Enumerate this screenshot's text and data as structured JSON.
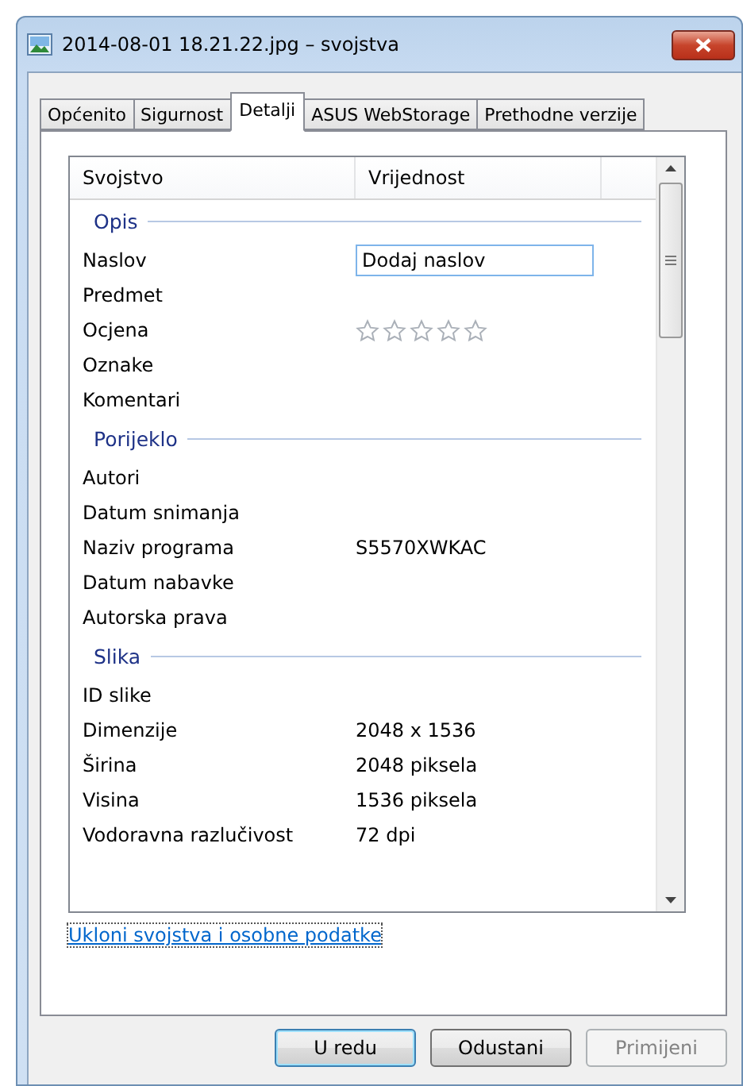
{
  "window": {
    "title": "2014-08-01 18.21.22.jpg – svojstva"
  },
  "tabs": [
    {
      "label": "Općenito",
      "selected": false
    },
    {
      "label": "Sigurnost",
      "selected": false
    },
    {
      "label": "Detalji",
      "selected": true
    },
    {
      "label": "ASUS WebStorage",
      "selected": false
    },
    {
      "label": "Prethodne verzije",
      "selected": false
    }
  ],
  "table": {
    "columns": [
      "Svojstvo",
      "Vrijednost"
    ],
    "groups": [
      {
        "title": "Opis",
        "rows": [
          {
            "kind": "field",
            "name": "Naslov",
            "placeholder": "Dodaj naslov"
          },
          {
            "kind": "text",
            "name": "Predmet"
          },
          {
            "kind": "stars",
            "name": "Ocjena",
            "stars": 0
          },
          {
            "kind": "text",
            "name": "Oznake"
          },
          {
            "kind": "text",
            "name": "Komentari"
          }
        ]
      },
      {
        "title": "Porijeklo",
        "rows": [
          {
            "kind": "text",
            "name": "Autori"
          },
          {
            "kind": "text",
            "name": "Datum snimanja"
          },
          {
            "kind": "text",
            "name": "Naziv programa",
            "value": "S5570XWKAC"
          },
          {
            "kind": "text",
            "name": "Datum nabavke"
          },
          {
            "kind": "text",
            "name": "Autorska prava"
          }
        ]
      },
      {
        "title": "Slika",
        "rows": [
          {
            "kind": "text",
            "name": "ID slike"
          },
          {
            "kind": "text",
            "name": "Dimenzije",
            "value": "2048 x 1536"
          },
          {
            "kind": "text",
            "name": "Širina",
            "value": "2048 piksela"
          },
          {
            "kind": "text",
            "name": "Visina",
            "value": "1536 piksela"
          },
          {
            "kind": "text",
            "name": "Vodoravna razlučivost",
            "value": "72 dpi"
          }
        ]
      }
    ]
  },
  "link": "Ukloni svojstva i osobne podatke",
  "buttons": [
    {
      "label": "U redu",
      "default": true,
      "disabled": false
    },
    {
      "label": "Odustani",
      "default": false,
      "disabled": false
    },
    {
      "label": "Primijeni",
      "default": false,
      "disabled": true
    }
  ]
}
